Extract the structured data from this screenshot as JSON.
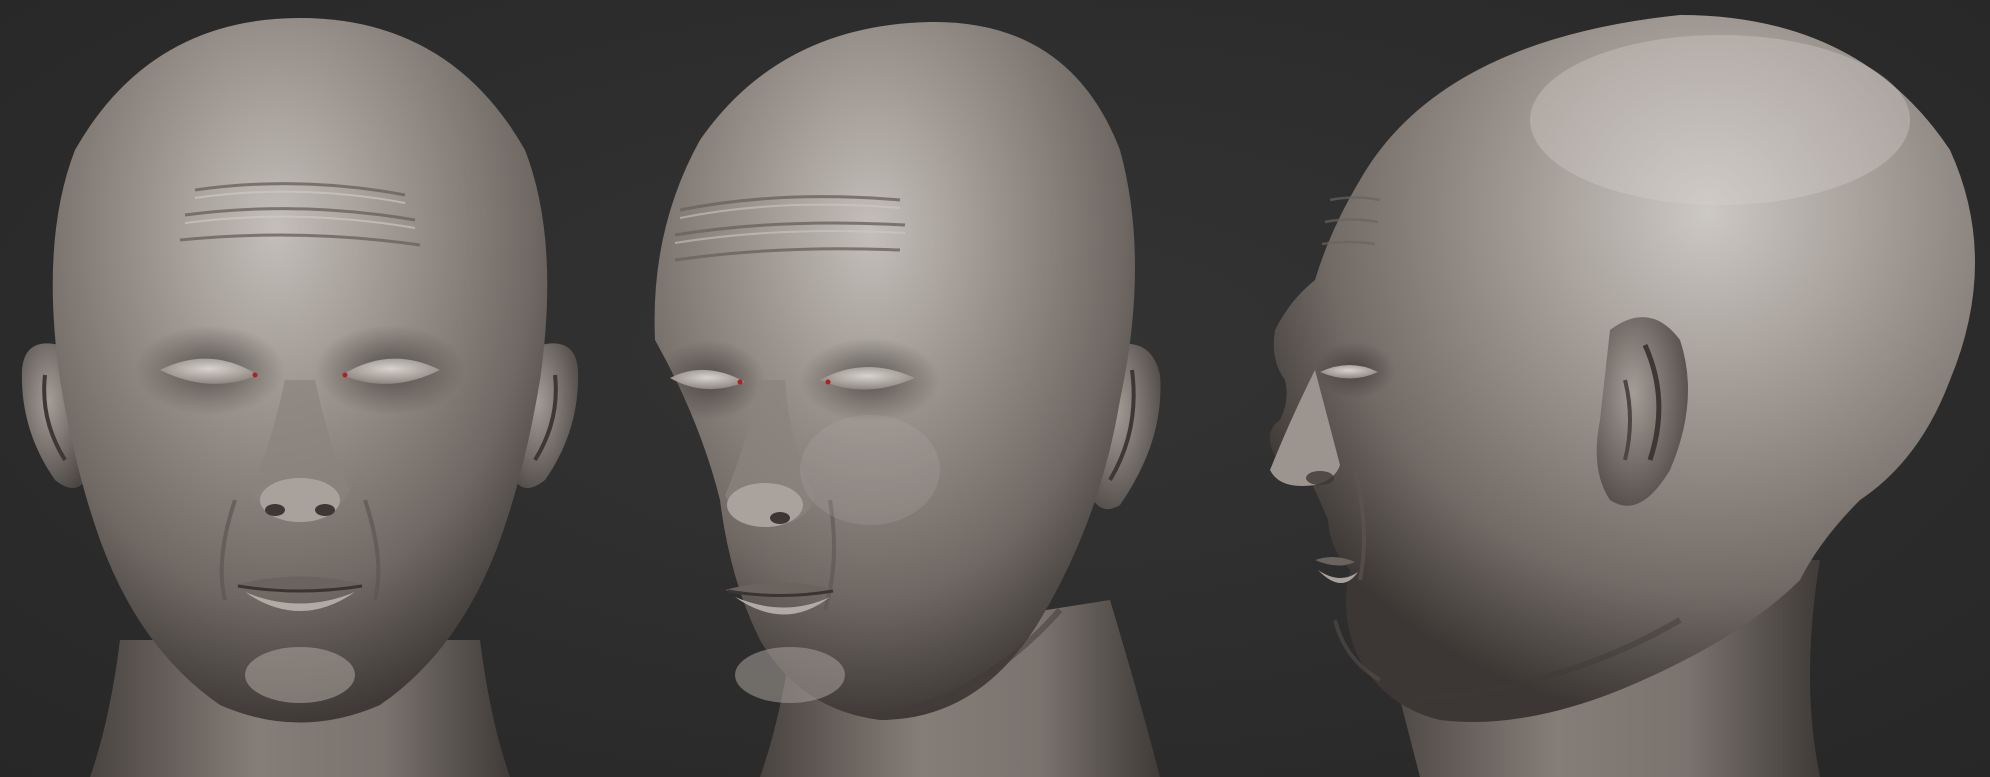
{
  "scene": {
    "background_color": "#2e2e2e",
    "clay_color": "#8e8680",
    "clay_highlight": "#c9c4bf",
    "clay_shadow": "#3a3532",
    "eye_accent": "#b02020"
  },
  "views": [
    {
      "name": "front",
      "icon": "head-front-sculpt"
    },
    {
      "name": "three-quarter",
      "icon": "head-three-quarter-sculpt"
    },
    {
      "name": "profile",
      "icon": "head-profile-sculpt"
    }
  ]
}
